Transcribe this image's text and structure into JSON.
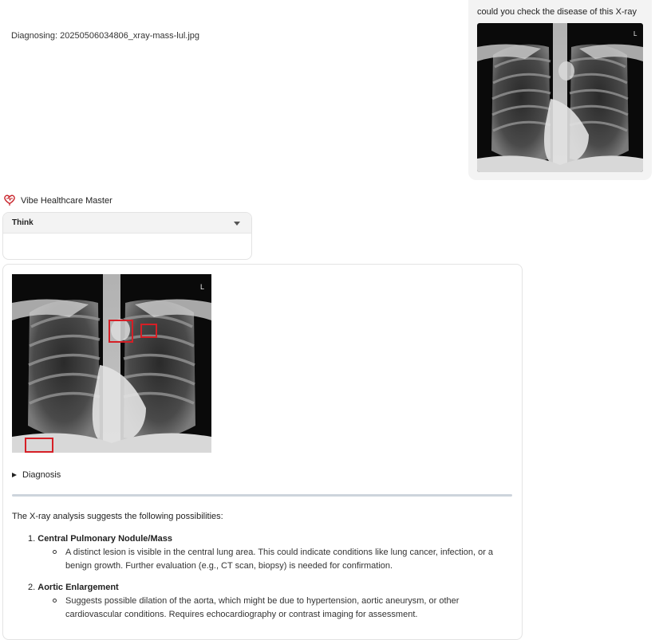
{
  "user_message": {
    "text": "could you check the disease of this X-ray",
    "image_marker": "L"
  },
  "assistant": {
    "name": "Vibe Healthcare Master",
    "logo_icon": "heart-stethoscope-icon",
    "think": {
      "title": "Think",
      "body": "Diagnosing: 20250506034806_xray-mass-lul.jpg"
    },
    "result": {
      "image_marker": "L",
      "details_label": "Diagnosis",
      "intro": "The X-ray analysis suggests the following possibilities:",
      "findings": [
        {
          "number": "1.",
          "title": "Central Pulmonary Nodule/Mass",
          "description": "A distinct lesion is visible in the central lung area. This could indicate conditions like lung cancer, infection, or a benign growth. Further evaluation (e.g., CT scan, biopsy) is needed for confirmation."
        },
        {
          "number": "2.",
          "title": "Aortic Enlargement",
          "description": "Suggests possible dilation of the aorta, which might be due to hypertension, aortic aneurysm, or other cardiovascular conditions. Requires echocardiography or contrast imaging for assessment."
        }
      ]
    }
  },
  "colors": {
    "detection_box": "#d61f26",
    "brand_red": "#c8242b",
    "divider": "#cdd4dc"
  }
}
